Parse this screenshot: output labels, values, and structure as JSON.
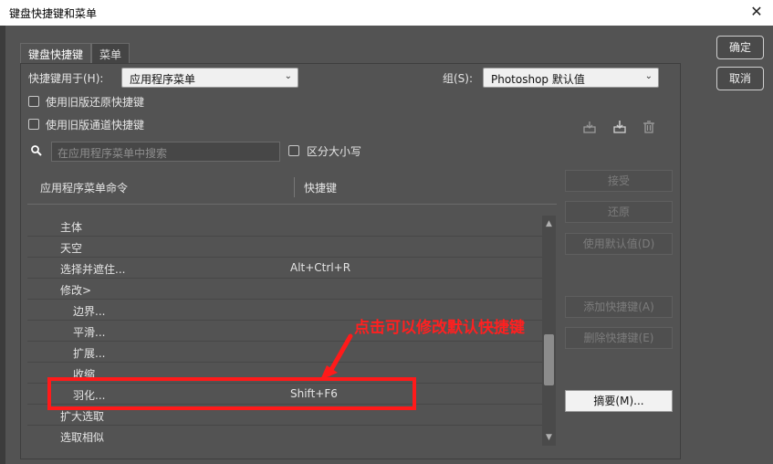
{
  "window": {
    "title": "键盘快捷键和菜单",
    "close_glyph": "✕"
  },
  "tabs": [
    {
      "label": "键盘快捷键",
      "active": true
    },
    {
      "label": "菜单",
      "active": false
    }
  ],
  "shortcuts_for": {
    "label": "快捷键用于(H):",
    "value": "应用程序菜单"
  },
  "set": {
    "label": "组(S):",
    "value": "Photoshop 默认值"
  },
  "options": {
    "legacy_undo": "使用旧版还原快捷键",
    "legacy_channel": "使用旧版通道快捷键"
  },
  "search": {
    "placeholder": "在应用程序菜单中搜索",
    "case_label": "区分大小写"
  },
  "columns": {
    "command": "应用程序菜单命令",
    "shortcut": "快捷键"
  },
  "rows": [
    {
      "name": "主体",
      "key": ""
    },
    {
      "name": "天空",
      "key": ""
    },
    {
      "name": "选择并遮住...",
      "key": "Alt+Ctrl+R"
    },
    {
      "name": "修改>",
      "key": ""
    },
    {
      "name": "边界...",
      "key": ""
    },
    {
      "name": "平滑...",
      "key": ""
    },
    {
      "name": "扩展...",
      "key": ""
    },
    {
      "name": "收缩",
      "key": ""
    },
    {
      "name": "羽化...",
      "key": "Shift+F6"
    },
    {
      "name": "扩大选取",
      "key": ""
    },
    {
      "name": "选取相似",
      "key": ""
    }
  ],
  "side_buttons": {
    "accept": "接受",
    "undo": "还原",
    "use_default": "使用默认值(D)",
    "add_shortcut": "添加快捷键(A)",
    "delete_shortcut": "删除快捷键(E)",
    "summarize": "摘要(M)..."
  },
  "dialog_buttons": {
    "ok": "确定",
    "cancel": "取消"
  },
  "annotation": {
    "text": "点击可以修改默认快捷键",
    "color": "#ff2020"
  },
  "icons": {
    "save_set": "save-set-icon",
    "new_set": "new-set-icon",
    "delete_set": "trash-icon",
    "search": "search-icon",
    "dropdown": "chevron-down-icon"
  }
}
